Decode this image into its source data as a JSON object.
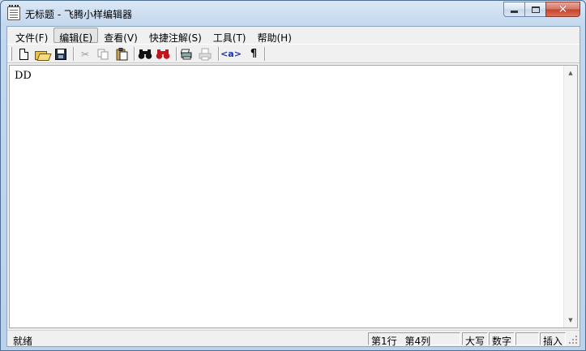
{
  "window": {
    "title": "无标题 - 飞腾小样编辑器"
  },
  "menu": {
    "items": [
      {
        "name": "menu-file",
        "label": "文件(F)",
        "active": false
      },
      {
        "name": "menu-edit",
        "label": "编辑(E)",
        "active": true
      },
      {
        "name": "menu-view",
        "label": "查看(V)",
        "active": false
      },
      {
        "name": "menu-annotation",
        "label": "快捷注解(S)",
        "active": false
      },
      {
        "name": "menu-tools",
        "label": "工具(T)",
        "active": false
      },
      {
        "name": "menu-help",
        "label": "帮助(H)",
        "active": false
      }
    ]
  },
  "toolbar": {
    "tag_label": "<a>",
    "paragraph_label": "¶",
    "icons": [
      "new-file-icon",
      "open-folder-icon",
      "save-icon",
      "cut-icon",
      "copy-icon",
      "paste-icon",
      "find-icon",
      "replace-icon",
      "print-preview-icon",
      "print-icon",
      "tag-icon",
      "paragraph-mark-icon"
    ]
  },
  "editor": {
    "content": "DD"
  },
  "status": {
    "ready": "就绪",
    "line": "第1行",
    "column": "第4列",
    "caps": "大写",
    "num": "数字",
    "scroll": "",
    "insert": "插入"
  }
}
